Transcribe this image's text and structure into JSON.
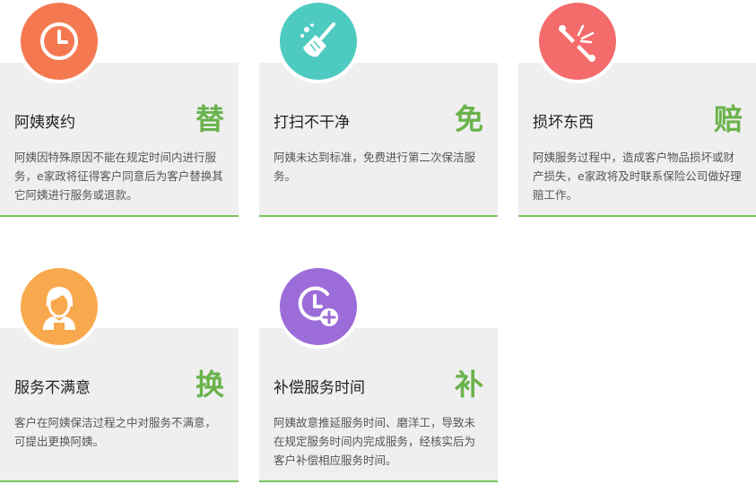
{
  "cards": [
    {
      "title": "阿姨爽约",
      "badge": "替",
      "description": "阿姨因特殊原因不能在规定时间内进行服务，e家政将征得客户同意后为客户替换其它阿姨进行服务或退款。",
      "icon": "clock-icon",
      "icon_color": "#f47950"
    },
    {
      "title": "打扫不干净",
      "badge": "免",
      "description": "阿姨未达到标准，免费进行第二次保洁服务。",
      "icon": "broom-icon",
      "icon_color": "#4ecbc0"
    },
    {
      "title": "损坏东西",
      "badge": "赔",
      "description": "阿姨服务过程中，造成客户物品损坏或财产损失，e家政将及时联系保险公司做好理赔工作。",
      "icon": "broken-item-icon",
      "icon_color": "#f36b6b"
    },
    {
      "title": "服务不满意",
      "badge": "换",
      "description": "客户在阿姨保洁过程之中对服务不满意，可提出更换阿姨。",
      "icon": "housekeeper-icon",
      "icon_color": "#f9a94d"
    },
    {
      "title": "补偿服务时间",
      "badge": "补",
      "description": "阿姨故意推延服务时间、磨洋工，导致未在规定服务时间内完成服务，经核实后为客户补偿相应服务时间。",
      "icon": "clock-plus-icon",
      "icon_color": "#9c6cd9"
    }
  ],
  "accent_color": "#6ab34c",
  "card_background": "#efefef"
}
